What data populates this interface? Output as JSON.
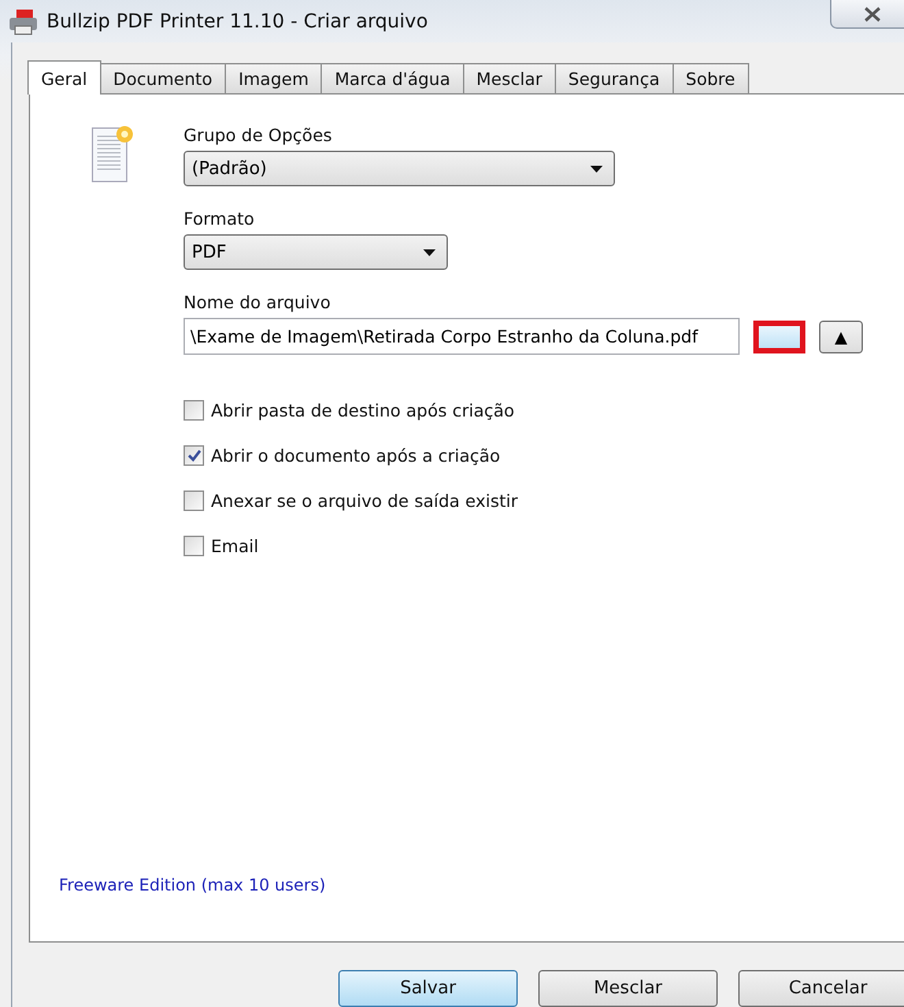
{
  "window": {
    "title": "Bullzip PDF Printer 11.10 - Criar arquivo"
  },
  "tabs": [
    {
      "label": "Geral",
      "selected": true
    },
    {
      "label": "Documento",
      "selected": false
    },
    {
      "label": "Imagem",
      "selected": false
    },
    {
      "label": "Marca d'água",
      "selected": false
    },
    {
      "label": "Mesclar",
      "selected": false
    },
    {
      "label": "Segurança",
      "selected": false
    },
    {
      "label": "Sobre",
      "selected": false
    }
  ],
  "option_group": {
    "label": "Grupo de Opções",
    "value": "(Padrão)"
  },
  "format": {
    "label": "Formato",
    "value": "PDF"
  },
  "file_name": {
    "label": "Nome do arquivo",
    "value": "\\Exame de Imagem\\Retirada Corpo Estranho da Coluna.pdf",
    "browse_highlighted": true,
    "up_symbol": "▲"
  },
  "options": [
    {
      "label": "Abrir pasta de destino após criação",
      "checked": false
    },
    {
      "label": "Abrir o documento após a criação",
      "checked": true
    },
    {
      "label": "Anexar se o arquivo de saída existir",
      "checked": false
    },
    {
      "label": "Email",
      "checked": false
    }
  ],
  "edition_note": "Freeware Edition (max 10 users)",
  "buttons": [
    {
      "label": "Salvar",
      "default": true
    },
    {
      "label": "Mesclar",
      "default": false
    },
    {
      "label": "Cancelar",
      "default": false
    }
  ]
}
